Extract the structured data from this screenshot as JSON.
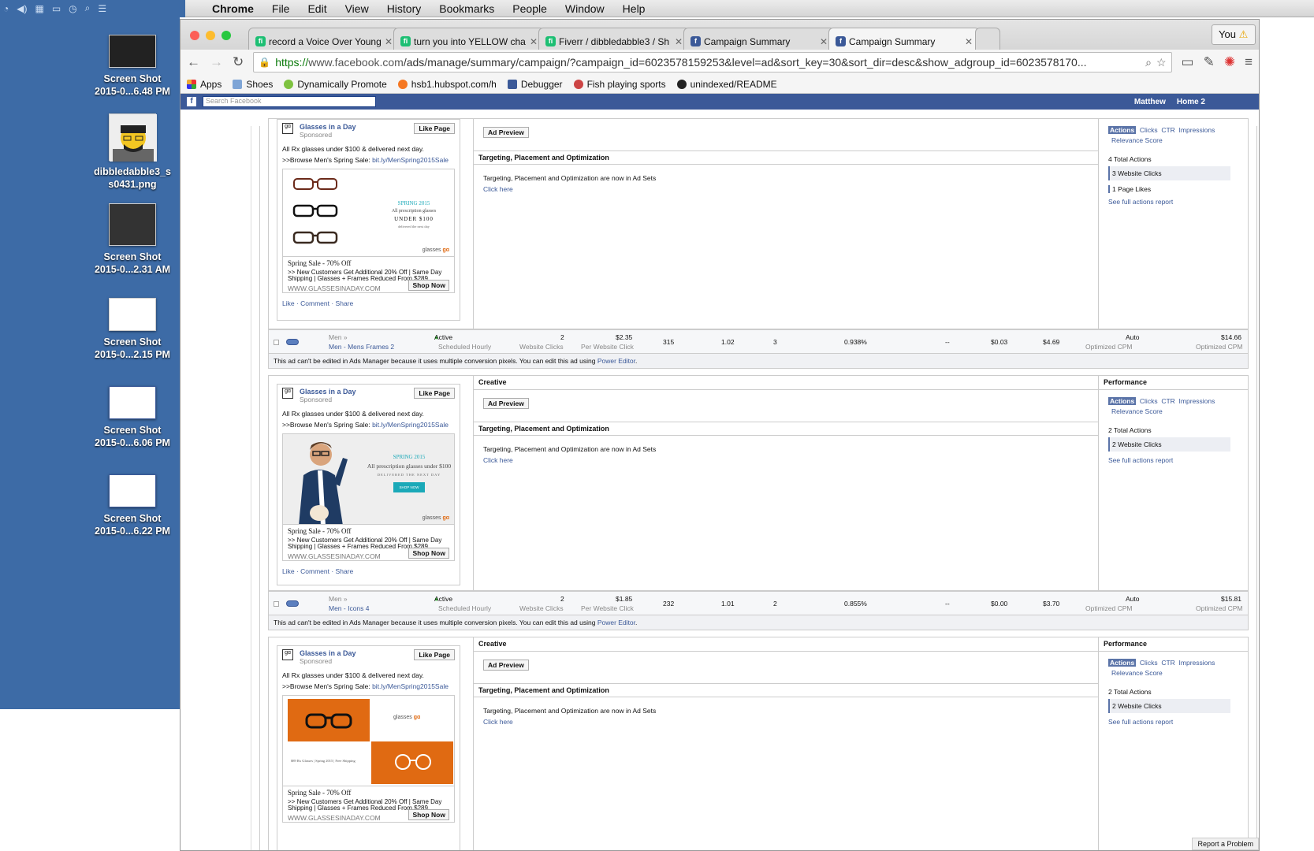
{
  "menubar": {
    "app": "Chrome",
    "items": [
      "File",
      "Edit",
      "View",
      "History",
      "Bookmarks",
      "People",
      "Window",
      "Help"
    ]
  },
  "desktop": {
    "icons": [
      {
        "line1": "Screen Shot",
        "line2": "2015-0...6.48 PM"
      },
      {
        "line1": "dibbledabble3_s",
        "line2": "s0431.png"
      },
      {
        "line1": "Screen Shot",
        "line2": "2015-0...2.31 AM"
      },
      {
        "line1": "Screen Shot",
        "line2": "2015-0...2.15 PM"
      },
      {
        "line1": "Screen Shot",
        "line2": "2015-0...6.06 PM"
      },
      {
        "line1": "Screen Shot",
        "line2": "2015-0...6.22 PM"
      }
    ]
  },
  "tabs": [
    {
      "title": "record a Voice Over Young",
      "favicon": "fiverr-icon"
    },
    {
      "title": "turn you into YELLOW cha",
      "favicon": "fiverr-icon"
    },
    {
      "title": "Fiverr / dibbledabble3 / Sh",
      "favicon": "fiverr-icon"
    },
    {
      "title": "Campaign Summary",
      "favicon": "facebook-icon"
    },
    {
      "title": "Campaign Summary",
      "favicon": "facebook-icon"
    }
  ],
  "profile_button": "You",
  "omnibox": {
    "scheme": "https://",
    "host": "www.facebook.com",
    "path": "/ads/manage/summary/campaign/?campaign_id=6023578159253&level=ad&sort_key=30&sort_dir=desc&show_adgroup_id=6023578170..."
  },
  "bookmarks": [
    "Apps",
    "Shoes",
    "Dynamically Promote",
    "hsb1.hubspot.com/h",
    "Debugger",
    "Fish playing sports",
    "unindexed/README"
  ],
  "fb": {
    "search_placeholder": "Search Facebook",
    "user": "Matthew",
    "home": "Home 2"
  },
  "ad": {
    "page_name": "Glasses in a Day",
    "sponsored": "Sponsored",
    "like_page": "Like Page",
    "line1": "All Rx glasses under $100 & delivered next day.",
    "line2_prefix": ">>Browse Men's Spring Sale: ",
    "line2_link": "bit.ly/MenSpring2015Sale",
    "headline": "Spring Sale - 70% Off",
    "desc": ">> New Customers Get Additional 20% Off | Same Day Shipping | Glasses + Frames Reduced From $289",
    "domain": "WWW.GLASSESINADAY.COM",
    "shop_now": "Shop Now",
    "actions": "Like · Comment · Share",
    "img1_text1": "SPRING 2015",
    "img1_text2": "All prescription glasses",
    "img1_text3": "UNDER $100",
    "img1_text4": "delivered the next day",
    "img2_text1": "SPRING 2015",
    "img2_text2": "All prescription glasses under $100",
    "img2_text3": "DELIVERED THE NEXT DAY",
    "img2_btn": "SHOP NOW",
    "img3_text": "$89 Rx Glasses | Spring 2015 | Free Shipping",
    "brand": "glasses"
  },
  "labels": {
    "creative": "Creative",
    "performance": "Performance",
    "ad_preview": "Ad Preview",
    "tpo_title": "Targeting, Placement and Optimization",
    "tpo_text": "Targeting, Placement and Optimization are now in Ad Sets",
    "click_here": "Click here",
    "tab_actions": "Actions",
    "tab_clicks": "Clicks",
    "tab_ctr": "CTR",
    "tab_impr": "Impressions",
    "tab_rel": "Relevance Score",
    "see_full": "See full actions report",
    "notice": "This ad can't be edited in Ads Manager because it uses multiple conversion pixels. You can edit this ad using ",
    "power_editor": "Power Editor",
    "report": "Report a Problem"
  },
  "perf": [
    {
      "total": "4 Total Actions",
      "clicks": "3 Website Clicks",
      "likes": "1 Page Likes"
    },
    {
      "total": "2 Total Actions",
      "clicks": "2 Website Clicks"
    },
    {
      "total": "2 Total Actions",
      "clicks": "2 Website Clicks"
    }
  ],
  "rows": [
    {
      "set": "Men »",
      "name": "Men - Mens Frames 2",
      "status": "Active",
      "sched": "Scheduled Hourly",
      "results": "2",
      "results_lbl": "Website Clicks",
      "cost": "$2.35",
      "cost_lbl": "Per Website Click",
      "reach": "315",
      "freq": "1.02",
      "clicks": "3",
      "ctr": "0.938%",
      "dash": "--",
      "cpc": "$0.03",
      "cpm": "$4.69",
      "bid": "Auto",
      "bid_lbl": "Optimized CPM",
      "spent": "$14.66",
      "spent_lbl": "Optimized CPM"
    },
    {
      "set": "Men »",
      "name": "Men - Icons 4",
      "status": "Active",
      "sched": "Scheduled Hourly",
      "results": "2",
      "results_lbl": "Website Clicks",
      "cost": "$1.85",
      "cost_lbl": "Per Website Click",
      "reach": "232",
      "freq": "1.01",
      "clicks": "2",
      "ctr": "0.855%",
      "dash": "--",
      "cpc": "$0.00",
      "cpm": "$3.70",
      "bid": "Auto",
      "bid_lbl": "Optimized CPM",
      "spent": "$15.81",
      "spent_lbl": "Optimized CPM"
    }
  ],
  "colors": {
    "fb_blue": "#3b5998",
    "desktop": "#3d6ba6",
    "orange": "#e06a12"
  }
}
